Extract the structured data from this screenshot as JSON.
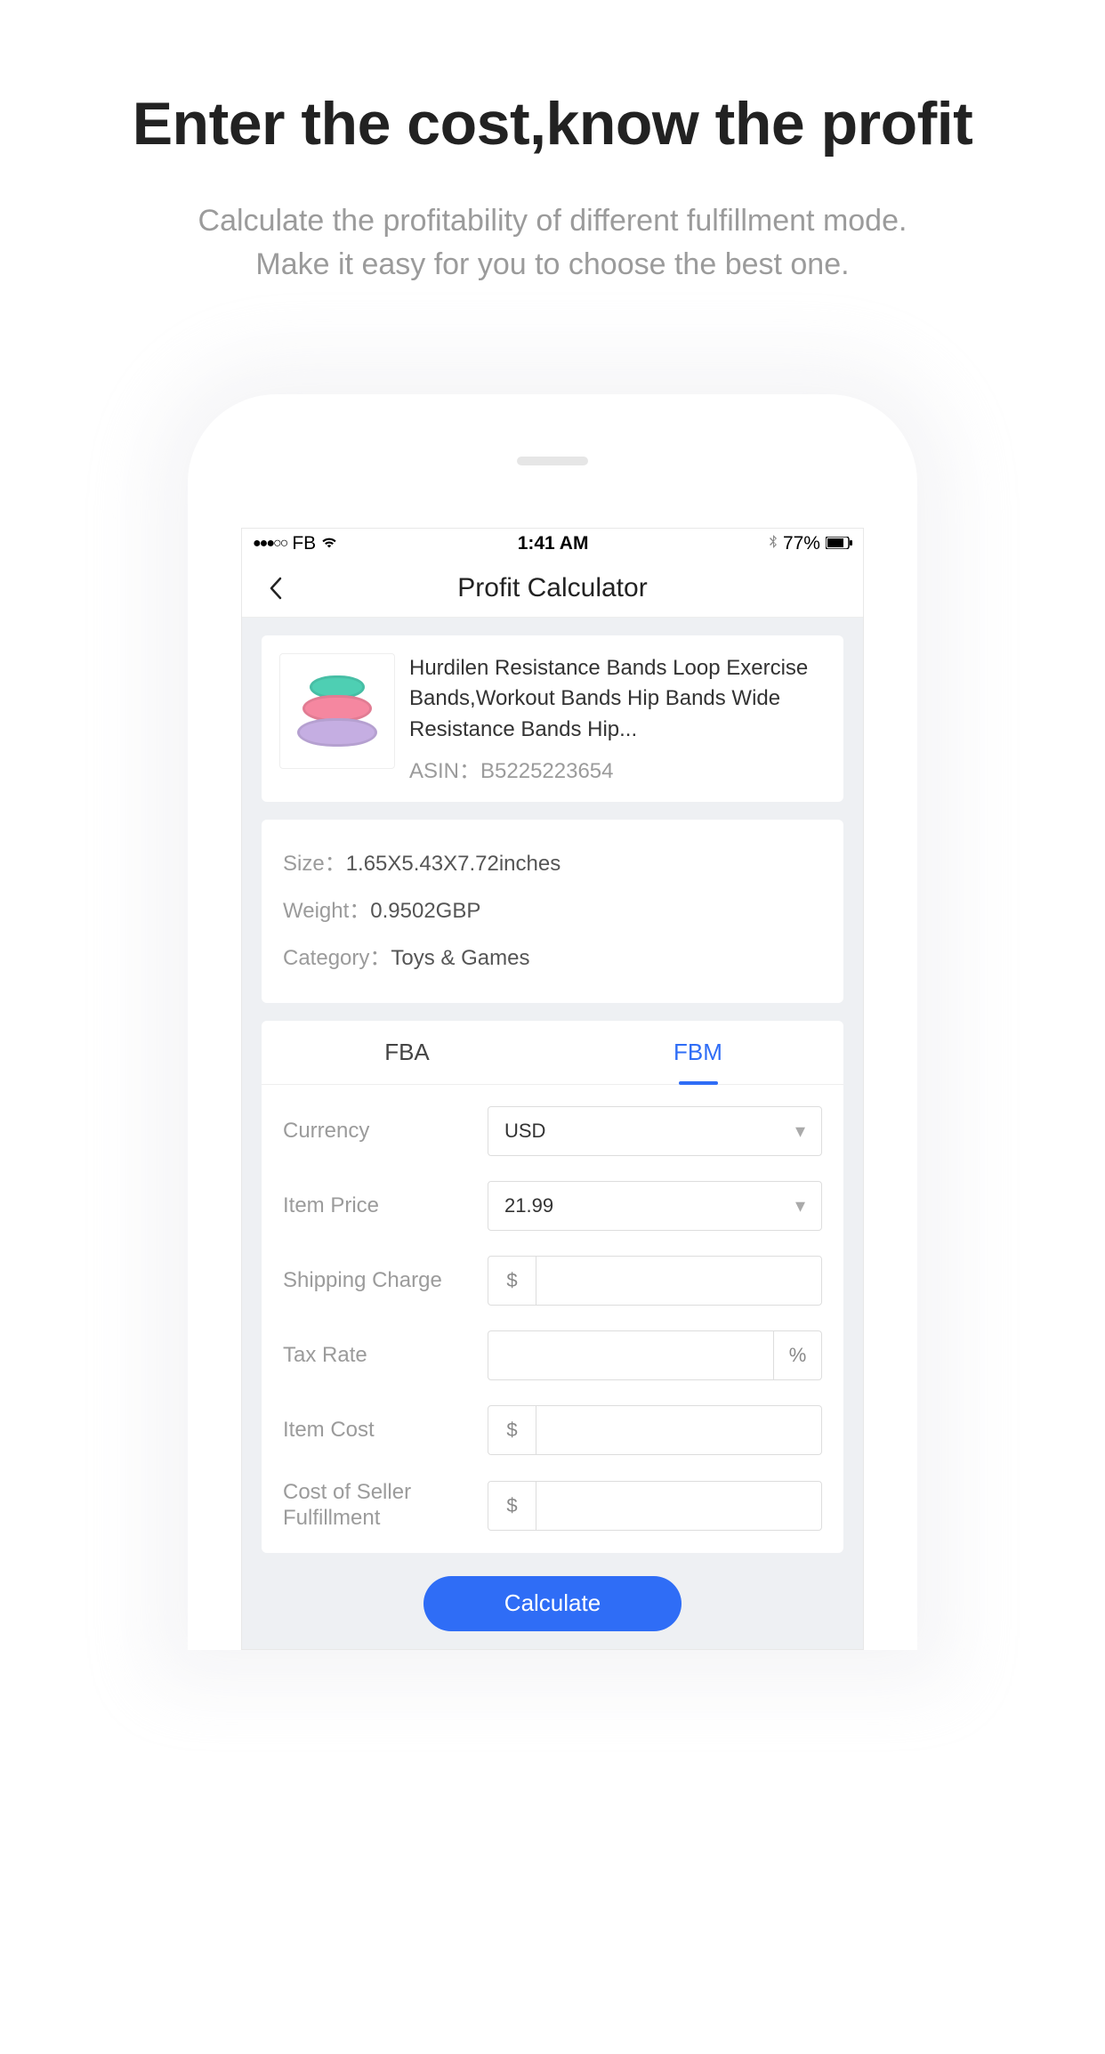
{
  "hero": {
    "title": "Enter the cost,know the profit",
    "subtitle_l1": "Calculate the profitability of different fulfillment mode.",
    "subtitle_l2": "Make it easy for you to choose the best one."
  },
  "status": {
    "carrier": "FB",
    "time": "1:41 AM",
    "battery": "77%"
  },
  "nav": {
    "title": "Profit Calculator"
  },
  "product": {
    "title": "Hurdilen Resistance Bands Loop Exercise Bands,Workout Bands Hip Bands Wide Resistance Bands Hip...",
    "asin_label": "ASIN：",
    "asin_value": "B5225223654"
  },
  "meta": {
    "size_label": "Size：",
    "size_value": "1.65X5.43X7.72inches",
    "weight_label": "Weight：",
    "weight_value": "0.9502GBP",
    "category_label": "Category：",
    "category_value": "Toys & Games"
  },
  "tabs": {
    "fba": "FBA",
    "fbm": "FBM"
  },
  "form": {
    "currency_label": "Currency",
    "currency_value": "USD",
    "item_price_label": "Item Price",
    "item_price_value": "21.99",
    "shipping_label": "Shipping Charge",
    "tax_label": "Tax Rate",
    "item_cost_label": "Item Cost",
    "cost_fulfillment_label": "Cost of Seller Fulfillment",
    "dollar": "$",
    "percent": "%"
  },
  "button": {
    "calculate": "Calculate"
  }
}
